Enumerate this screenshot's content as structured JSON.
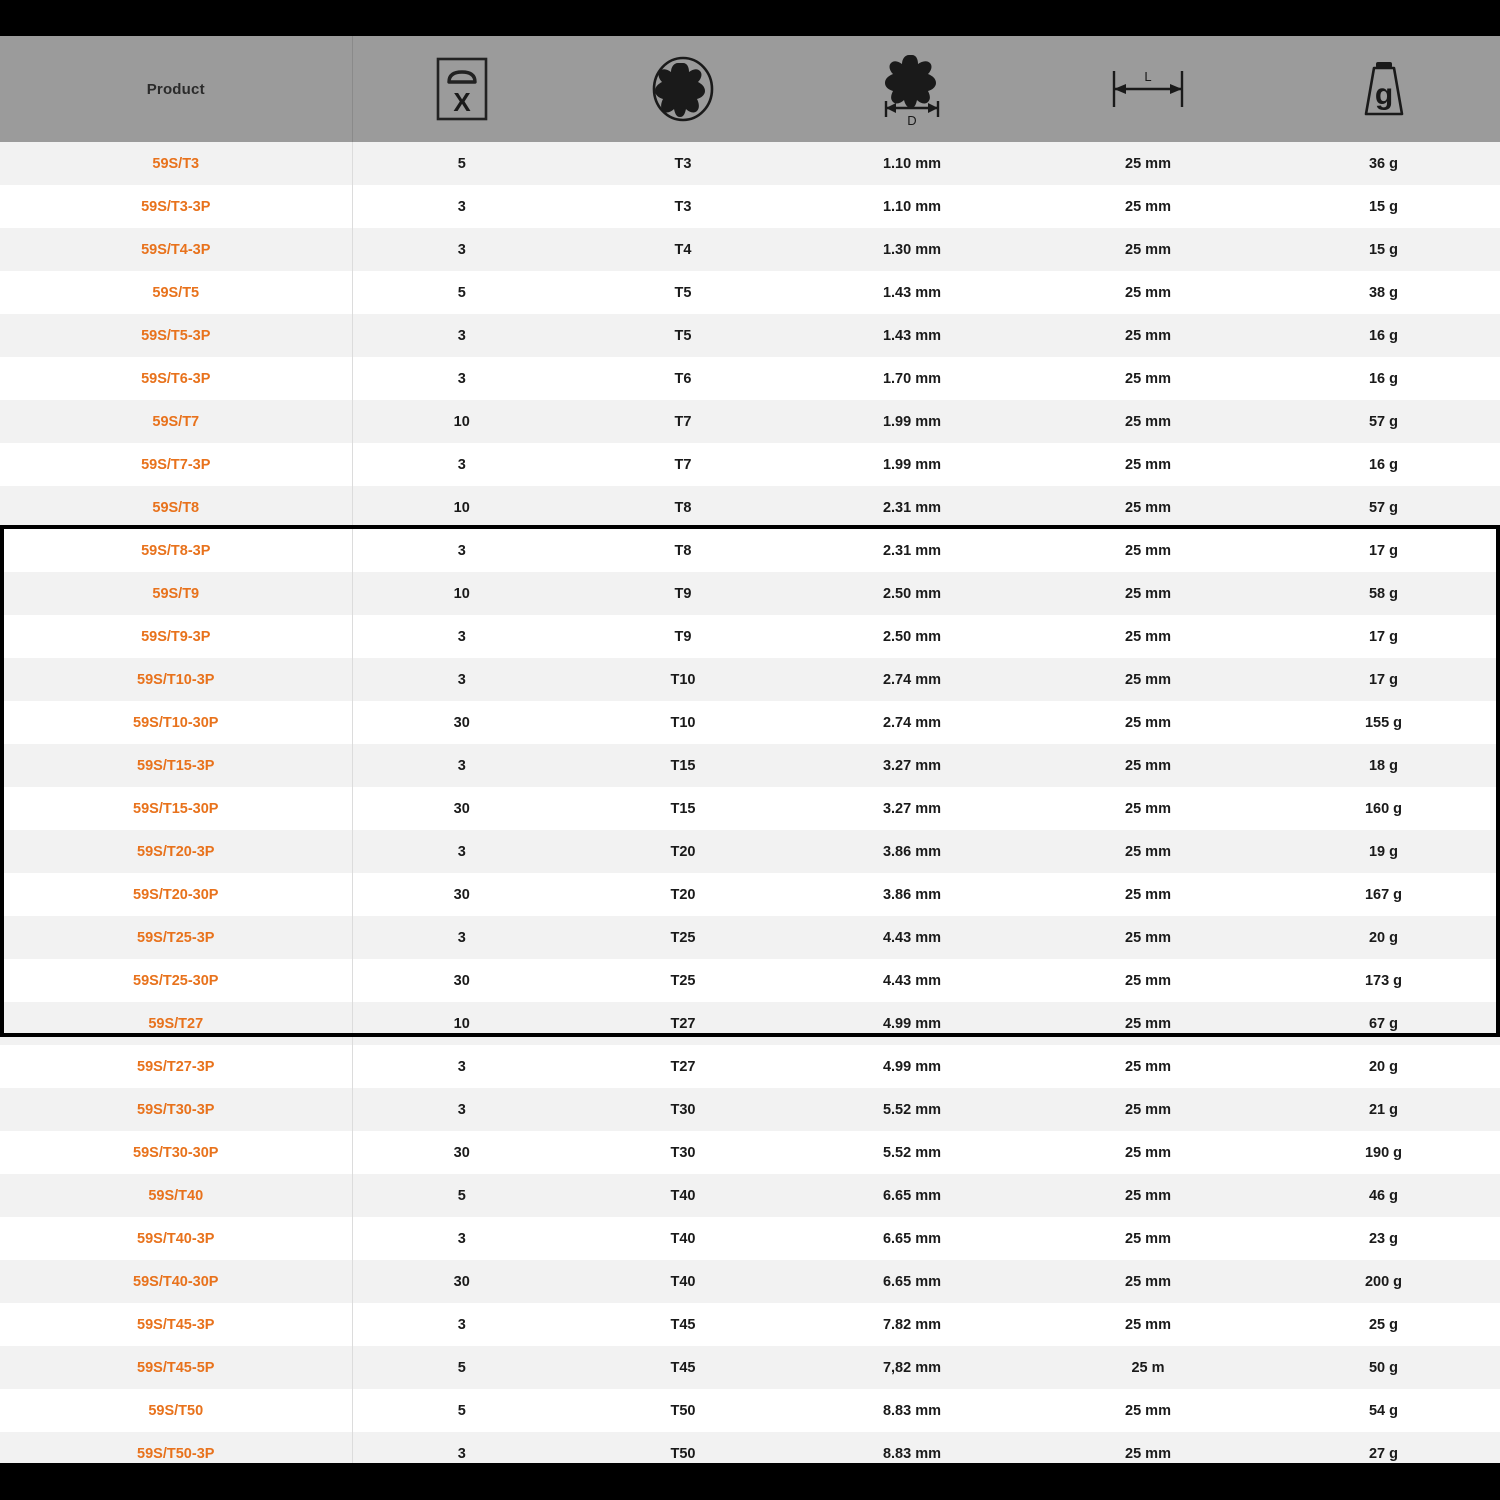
{
  "table": {
    "columns": [
      {
        "key": "product",
        "label": "Product",
        "icon": "none"
      },
      {
        "key": "pack_quantity",
        "label": "",
        "icon": "package-quantity-icon",
        "icon_letter": "X"
      },
      {
        "key": "drive_size",
        "label": "",
        "icon": "torx-drive-icon"
      },
      {
        "key": "diameter",
        "label": "",
        "icon": "torx-diameter-icon",
        "icon_letter": "D"
      },
      {
        "key": "length",
        "label": "",
        "icon": "length-dimension-icon",
        "icon_letter": "L"
      },
      {
        "key": "weight",
        "label": "",
        "icon": "weight-icon",
        "icon_letter": "g"
      }
    ],
    "rows": [
      {
        "product": "59S/T3",
        "pack_quantity": "5",
        "drive_size": "T3",
        "diameter": "1.10 mm",
        "length": "25 mm",
        "weight": "36 g"
      },
      {
        "product": "59S/T3-3P",
        "pack_quantity": "3",
        "drive_size": "T3",
        "diameter": "1.10 mm",
        "length": "25 mm",
        "weight": "15 g"
      },
      {
        "product": "59S/T4-3P",
        "pack_quantity": "3",
        "drive_size": "T4",
        "diameter": "1.30 mm",
        "length": "25 mm",
        "weight": "15 g"
      },
      {
        "product": "59S/T5",
        "pack_quantity": "5",
        "drive_size": "T5",
        "diameter": "1.43 mm",
        "length": "25 mm",
        "weight": "38 g"
      },
      {
        "product": "59S/T5-3P",
        "pack_quantity": "3",
        "drive_size": "T5",
        "diameter": "1.43 mm",
        "length": "25 mm",
        "weight": "16 g"
      },
      {
        "product": "59S/T6-3P",
        "pack_quantity": "3",
        "drive_size": "T6",
        "diameter": "1.70 mm",
        "length": "25 mm",
        "weight": "16 g"
      },
      {
        "product": "59S/T7",
        "pack_quantity": "10",
        "drive_size": "T7",
        "diameter": "1.99 mm",
        "length": "25 mm",
        "weight": "57 g"
      },
      {
        "product": "59S/T7-3P",
        "pack_quantity": "3",
        "drive_size": "T7",
        "diameter": "1.99 mm",
        "length": "25 mm",
        "weight": "16 g"
      },
      {
        "product": "59S/T8",
        "pack_quantity": "10",
        "drive_size": "T8",
        "diameter": "2.31 mm",
        "length": "25 mm",
        "weight": "57 g"
      },
      {
        "product": "59S/T8-3P",
        "pack_quantity": "3",
        "drive_size": "T8",
        "diameter": "2.31 mm",
        "length": "25 mm",
        "weight": "17 g"
      },
      {
        "product": "59S/T9",
        "pack_quantity": "10",
        "drive_size": "T9",
        "diameter": "2.50 mm",
        "length": "25 mm",
        "weight": "58 g"
      },
      {
        "product": "59S/T9-3P",
        "pack_quantity": "3",
        "drive_size": "T9",
        "diameter": "2.50 mm",
        "length": "25 mm",
        "weight": "17 g"
      },
      {
        "product": "59S/T10-3P",
        "pack_quantity": "3",
        "drive_size": "T10",
        "diameter": "2.74 mm",
        "length": "25 mm",
        "weight": "17 g"
      },
      {
        "product": "59S/T10-30P",
        "pack_quantity": "30",
        "drive_size": "T10",
        "diameter": "2.74 mm",
        "length": "25 mm",
        "weight": "155 g"
      },
      {
        "product": "59S/T15-3P",
        "pack_quantity": "3",
        "drive_size": "T15",
        "diameter": "3.27 mm",
        "length": "25 mm",
        "weight": "18 g"
      },
      {
        "product": "59S/T15-30P",
        "pack_quantity": "30",
        "drive_size": "T15",
        "diameter": "3.27 mm",
        "length": "25 mm",
        "weight": "160 g"
      },
      {
        "product": "59S/T20-3P",
        "pack_quantity": "3",
        "drive_size": "T20",
        "diameter": "3.86 mm",
        "length": "25 mm",
        "weight": "19 g"
      },
      {
        "product": "59S/T20-30P",
        "pack_quantity": "30",
        "drive_size": "T20",
        "diameter": "3.86 mm",
        "length": "25 mm",
        "weight": "167 g"
      },
      {
        "product": "59S/T25-3P",
        "pack_quantity": "3",
        "drive_size": "T25",
        "diameter": "4.43 mm",
        "length": "25 mm",
        "weight": "20 g"
      },
      {
        "product": "59S/T25-30P",
        "pack_quantity": "30",
        "drive_size": "T25",
        "diameter": "4.43 mm",
        "length": "25 mm",
        "weight": "173 g"
      },
      {
        "product": "59S/T27",
        "pack_quantity": "10",
        "drive_size": "T27",
        "diameter": "4.99 mm",
        "length": "25 mm",
        "weight": "67 g"
      },
      {
        "product": "59S/T27-3P",
        "pack_quantity": "3",
        "drive_size": "T27",
        "diameter": "4.99 mm",
        "length": "25 mm",
        "weight": "20 g"
      },
      {
        "product": "59S/T30-3P",
        "pack_quantity": "3",
        "drive_size": "T30",
        "diameter": "5.52 mm",
        "length": "25 mm",
        "weight": "21 g"
      },
      {
        "product": "59S/T30-30P",
        "pack_quantity": "30",
        "drive_size": "T30",
        "diameter": "5.52 mm",
        "length": "25 mm",
        "weight": "190 g"
      },
      {
        "product": "59S/T40",
        "pack_quantity": "5",
        "drive_size": "T40",
        "diameter": "6.65 mm",
        "length": "25 mm",
        "weight": "46 g"
      },
      {
        "product": "59S/T40-3P",
        "pack_quantity": "3",
        "drive_size": "T40",
        "diameter": "6.65 mm",
        "length": "25 mm",
        "weight": "23 g"
      },
      {
        "product": "59S/T40-30P",
        "pack_quantity": "30",
        "drive_size": "T40",
        "diameter": "6.65 mm",
        "length": "25 mm",
        "weight": "200 g"
      },
      {
        "product": "59S/T45-3P",
        "pack_quantity": "3",
        "drive_size": "T45",
        "diameter": "7.82 mm",
        "length": "25 mm",
        "weight": "25 g"
      },
      {
        "product": "59S/T45-5P",
        "pack_quantity": "5",
        "drive_size": "T45",
        "diameter": "7,82 mm",
        "length": "25 m",
        "weight": "50 g"
      },
      {
        "product": "59S/T50",
        "pack_quantity": "5",
        "drive_size": "T50",
        "diameter": "8.83 mm",
        "length": "25 mm",
        "weight": "54 g"
      },
      {
        "product": "59S/T50-3P",
        "pack_quantity": "3",
        "drive_size": "T50",
        "diameter": "8.83 mm",
        "length": "25 mm",
        "weight": "27 g"
      }
    ]
  },
  "colors": {
    "product_orange": "#e8721c",
    "header_gray": "#9b9b9b",
    "row_alt_gray": "#f2f2f2",
    "row_white": "#ffffff",
    "text_dark": "#1a1a1a",
    "band_black": "#000000"
  }
}
